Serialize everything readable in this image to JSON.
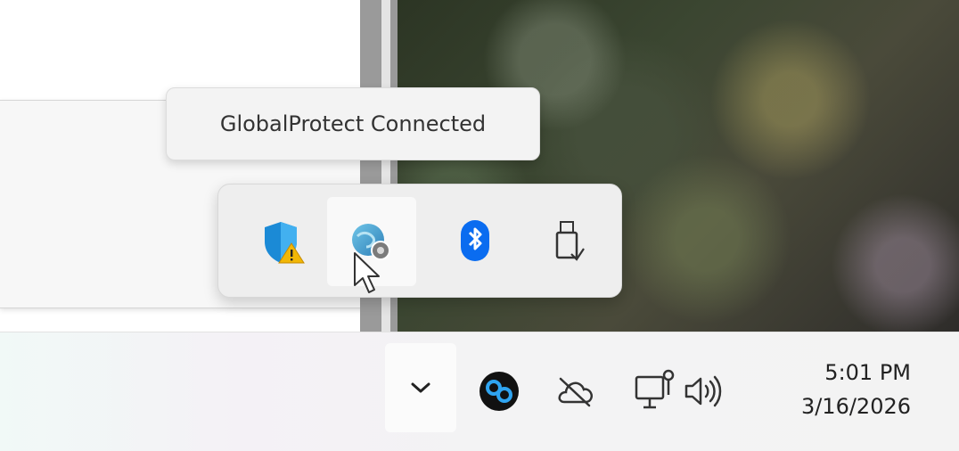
{
  "tooltip": {
    "text": "GlobalProtect Connected"
  },
  "flyout": {
    "items": [
      {
        "name": "windows-security",
        "icon": "shield-warning-icon",
        "hovered": false
      },
      {
        "name": "globalprotect",
        "icon": "globalprotect-icon",
        "hovered": true
      },
      {
        "name": "bluetooth",
        "icon": "bluetooth-icon",
        "hovered": false
      },
      {
        "name": "usb-device",
        "icon": "usb-drive-icon",
        "hovered": false
      }
    ]
  },
  "taskbar": {
    "tray": {
      "overflow_icon": "chevron-down-icon",
      "icons": [
        "app-circle-icon",
        "cloud-offline-icon",
        "network-icon",
        "volume-icon"
      ]
    },
    "clock": {
      "time": "5:01 PM",
      "date": "3/16/2026"
    }
  },
  "colors": {
    "accent_blue": "#1a73e8",
    "bluetooth_blue": "#0a6cf0",
    "warning_yellow": "#f2b705",
    "taskbar": "#f3f3f3"
  }
}
